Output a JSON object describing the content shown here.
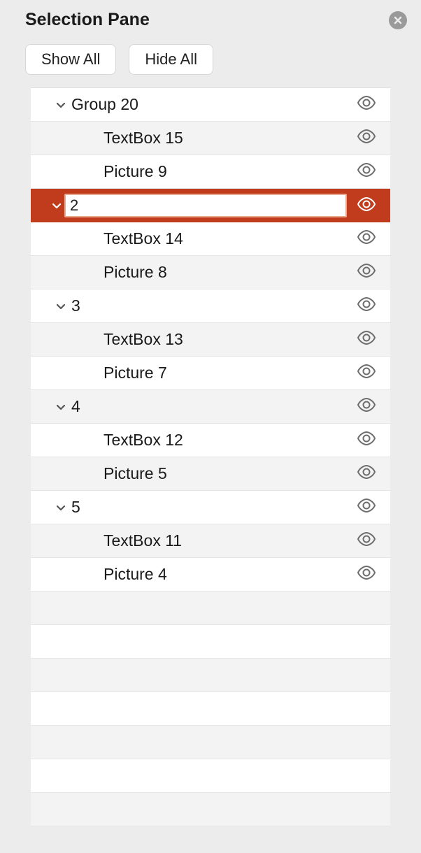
{
  "title": "Selection Pane",
  "buttons": {
    "show_all": "Show All",
    "hide_all": "Hide All"
  },
  "editing_value": "2",
  "colors": {
    "selected_bg": "#c03c1d"
  },
  "items": [
    {
      "type": "group",
      "label": "Group 20",
      "expanded": true,
      "visible": true,
      "selected": false,
      "editing": false,
      "children": [
        {
          "label": "TextBox 15",
          "visible": true
        },
        {
          "label": "Picture 9",
          "visible": true
        }
      ]
    },
    {
      "type": "group",
      "label": "2",
      "expanded": true,
      "visible": true,
      "selected": true,
      "editing": true,
      "children": [
        {
          "label": "TextBox 14",
          "visible": true
        },
        {
          "label": "Picture 8",
          "visible": true
        }
      ]
    },
    {
      "type": "group",
      "label": "3",
      "expanded": true,
      "visible": true,
      "selected": false,
      "editing": false,
      "children": [
        {
          "label": "TextBox 13",
          "visible": true
        },
        {
          "label": "Picture 7",
          "visible": true
        }
      ]
    },
    {
      "type": "group",
      "label": "4",
      "expanded": true,
      "visible": true,
      "selected": false,
      "editing": false,
      "children": [
        {
          "label": "TextBox 12",
          "visible": true
        },
        {
          "label": "Picture 5",
          "visible": true
        }
      ]
    },
    {
      "type": "group",
      "label": "5",
      "expanded": true,
      "visible": true,
      "selected": false,
      "editing": false,
      "children": [
        {
          "label": "TextBox 11",
          "visible": true
        },
        {
          "label": "Picture 4",
          "visible": true
        }
      ]
    }
  ],
  "empty_rows_after": 7
}
